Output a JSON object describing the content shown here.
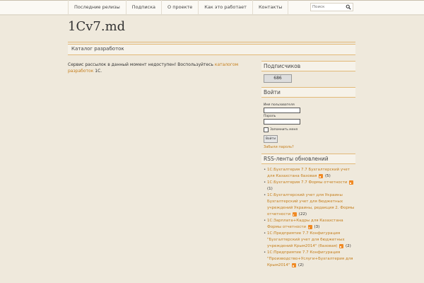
{
  "nav": {
    "items": [
      "Последние релизы",
      "Подписка",
      "О проекте",
      "Как это работает",
      "Контакты"
    ]
  },
  "search": {
    "placeholder": "Поиск"
  },
  "site": {
    "title": "1Cv7.md"
  },
  "breadcrumb": {
    "label": "Каталог разработок"
  },
  "main": {
    "message": "Сервис рассылок в данный момент недоступен! Воспользуйтесь",
    "link": "каталогом разработок",
    "suffix": "1С."
  },
  "subscribers": {
    "title": "Подписчиков",
    "count": "686"
  },
  "login": {
    "title": "Войти",
    "username_label": "Имя пользователя",
    "password_label": "Пароль",
    "remember_label": "Запомнить меня",
    "submit_label": "Войти",
    "forgot_label": "Забыли пароль?"
  },
  "rss": {
    "title": "RSS-ленты обновлений",
    "items": [
      {
        "link": "1С:Бухгалтерия 7.7 Бухгалтерский учет для Казахстана базовая",
        "count": "(5)"
      },
      {
        "link": "1С:Бухгалтерия 7.7 Формы отчетности",
        "count": "(1)"
      },
      {
        "link": "1С:Бухгалтерский учет для Украины Бухгалтерский учет для бюджетных учреждений Украины, редакция 2. Формы отчетности",
        "count": "(22)"
      },
      {
        "link": "1С:Зарплата+Кадры для Казахстана Формы отчетности",
        "count": "(3)"
      },
      {
        "link": "1С:Предприятие 7.7 Конфигурация \"Бухгалтерский учет для бюджетных учреждений Крым2014\" (базовая)",
        "count": "(2)"
      },
      {
        "link": "1С:Предприятие 7.7 Конфигурация \"Производство+Услуги+Бухгалтерия для Крым2014\"",
        "count": "(2)"
      }
    ]
  },
  "colors": {
    "accent": "#e2b978",
    "link": "#c47d1a",
    "rss": "#f08a24",
    "background": "#efe9dc"
  }
}
